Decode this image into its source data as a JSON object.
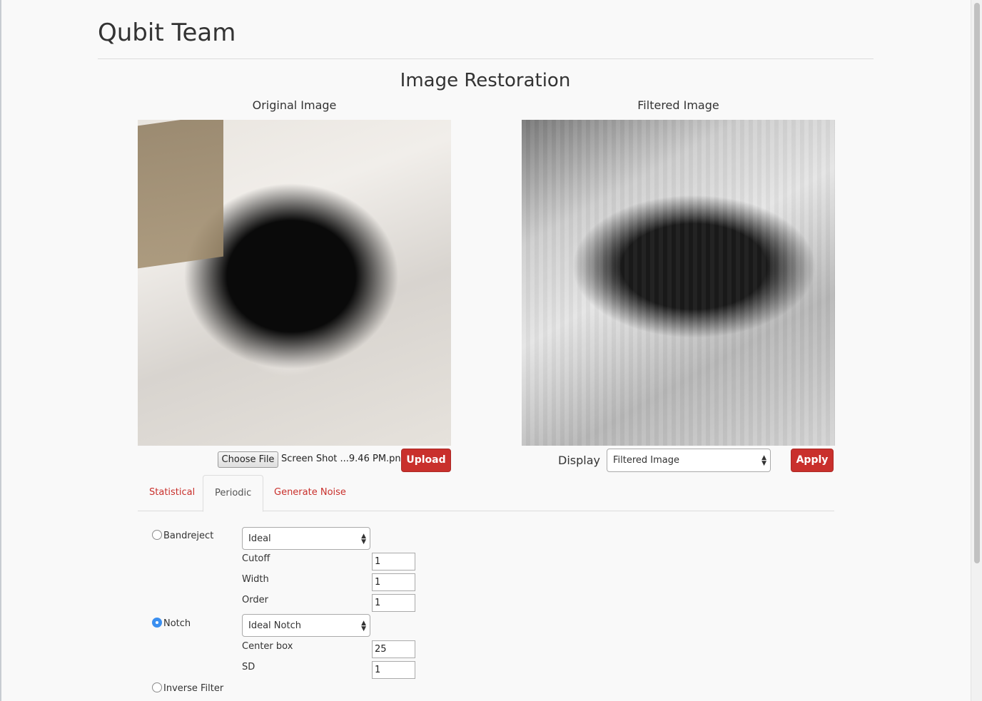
{
  "header": {
    "brand": "Qubit Team"
  },
  "page": {
    "title": "Image Restoration"
  },
  "original": {
    "caption": "Original Image",
    "choose_file_label": "Choose File",
    "file_name": "Screen Shot ...9.46 PM.png",
    "upload_label": "Upload"
  },
  "filtered": {
    "caption": "Filtered Image",
    "display_label": "Display",
    "display_value": "Filtered Image",
    "apply_label": "Apply"
  },
  "tabs": [
    {
      "label": "Statistical",
      "active": false
    },
    {
      "label": "Periodic",
      "active": true
    },
    {
      "label": "Generate Noise",
      "active": false
    }
  ],
  "periodic": {
    "bandreject": {
      "label": "Bandreject",
      "checked": false,
      "type_value": "Ideal",
      "params": [
        {
          "label": "Cutoff",
          "value": "1"
        },
        {
          "label": "Width",
          "value": "1"
        },
        {
          "label": "Order",
          "value": "1"
        }
      ]
    },
    "notch": {
      "label": "Notch",
      "checked": true,
      "type_value": "Ideal Notch",
      "params": [
        {
          "label": "Center box",
          "value": "25"
        },
        {
          "label": "SD",
          "value": "1"
        }
      ]
    },
    "inverse": {
      "label": "Inverse Filter",
      "checked": false
    }
  },
  "colors": {
    "accent": "#c9302c",
    "radio_checked": "#3b8ff0"
  }
}
